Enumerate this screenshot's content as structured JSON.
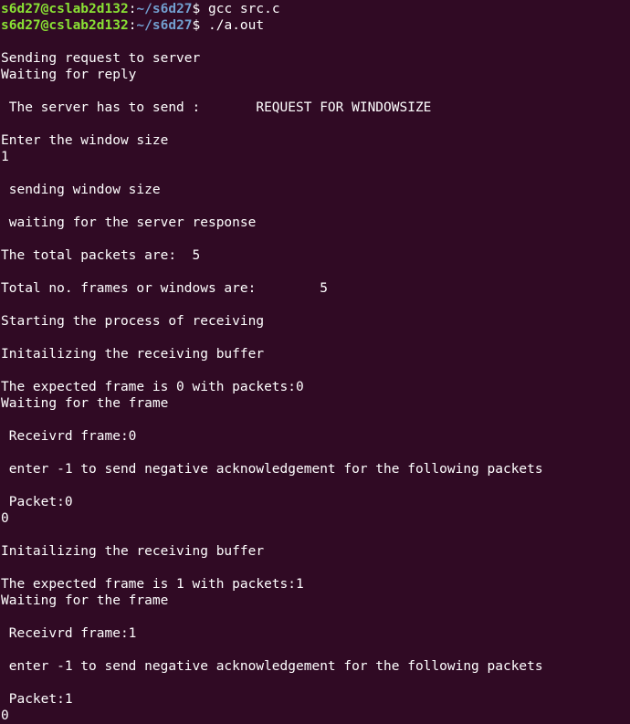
{
  "prompt": {
    "user_host": "s6d27@cslab2d132",
    "colon": ":",
    "path": "~/s6d27",
    "symbol": "$ "
  },
  "commands": [
    "gcc src.c",
    "./a.out"
  ],
  "output": [
    "",
    "Sending request to server",
    "Waiting for reply",
    "",
    " The server has to send :       REQUEST FOR WINDOWSIZE",
    "",
    "Enter the window size",
    "1",
    "",
    " sending window size",
    "",
    " waiting for the server response",
    "",
    "The total packets are:  5",
    "",
    "Total no. frames or windows are:        5",
    "",
    "Starting the process of receiving",
    "",
    "Initailizing the receiving buffer",
    "",
    "The expected frame is 0 with packets:0",
    "Waiting for the frame",
    "",
    " Receivrd frame:0",
    "",
    " enter -1 to send negative acknowledgement for the following packets",
    "",
    " Packet:0",
    "0",
    "",
    "Initailizing the receiving buffer",
    "",
    "The expected frame is 1 with packets:1",
    "Waiting for the frame",
    "",
    " Receivrd frame:1",
    "",
    " enter -1 to send negative acknowledgement for the following packets",
    "",
    " Packet:1",
    "0"
  ]
}
